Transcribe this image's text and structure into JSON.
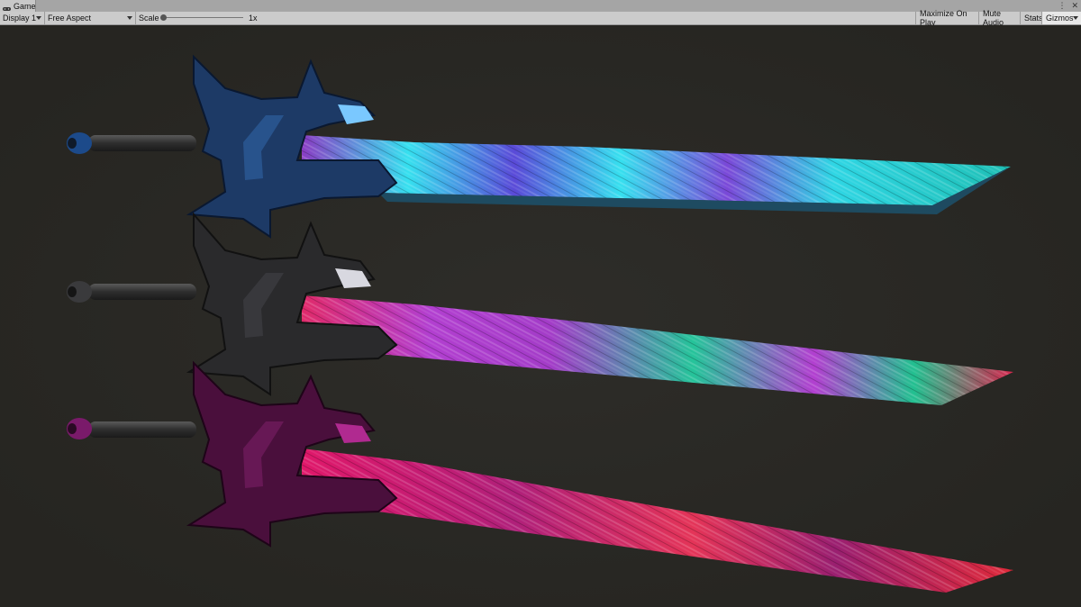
{
  "window": {
    "tab_label": "Game",
    "tab_icon": "gamepad-icon",
    "menu_icon": "kebab-menu-icon",
    "close_icon": "close-icon"
  },
  "toolbar": {
    "display": "Display 1",
    "aspect": "Free Aspect",
    "scale_label": "Scale",
    "scale_value": "1x",
    "maximize_on_play": "Maximize On Play",
    "mute_audio": "Mute Audio",
    "stats": "Stats",
    "gizmos": "Gizmos"
  },
  "scene": {
    "background_color": "#2b2a26",
    "swords": [
      {
        "name": "blue",
        "guard_color": "#1d3a66",
        "blade_colors": [
          "#8a3cc4",
          "#36e0ef",
          "#6a4adf",
          "#1fc9c9"
        ]
      },
      {
        "name": "black",
        "guard_color": "#2a2a2c",
        "blade_colors": [
          "#e02a6a",
          "#b23fd0",
          "#25c49a",
          "#d8264e"
        ]
      },
      {
        "name": "magenta",
        "guard_color": "#4a0f3c",
        "blade_colors": [
          "#e0186a",
          "#b0207a",
          "#e43458",
          "#8a1d6a"
        ]
      }
    ]
  }
}
